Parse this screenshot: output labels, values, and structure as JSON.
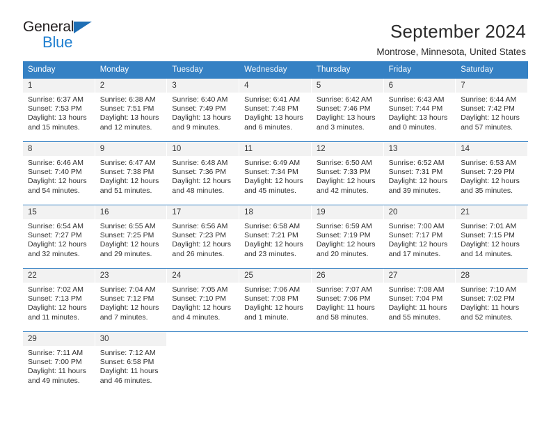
{
  "brand": {
    "name_part1": "General",
    "name_part2": "Blue",
    "triangle_icon": "triangle-icon",
    "accent_color": "#1f7fd0",
    "logo_dark_color": "#231f20"
  },
  "header": {
    "title": "September 2024",
    "subtitle": "Montrose, Minnesota, United States"
  },
  "theme": {
    "header_bar_color": "#3581c4",
    "daynum_band_color": "#f2f2f2",
    "text_color": "#2f2f2f"
  },
  "weekdays": [
    "Sunday",
    "Monday",
    "Tuesday",
    "Wednesday",
    "Thursday",
    "Friday",
    "Saturday"
  ],
  "weeks": [
    {
      "days": [
        {
          "num": "1",
          "sunrise": "Sunrise: 6:37 AM",
          "sunset": "Sunset: 7:53 PM",
          "daylight_line1": "Daylight: 13 hours",
          "daylight_line2": "and 15 minutes."
        },
        {
          "num": "2",
          "sunrise": "Sunrise: 6:38 AM",
          "sunset": "Sunset: 7:51 PM",
          "daylight_line1": "Daylight: 13 hours",
          "daylight_line2": "and 12 minutes."
        },
        {
          "num": "3",
          "sunrise": "Sunrise: 6:40 AM",
          "sunset": "Sunset: 7:49 PM",
          "daylight_line1": "Daylight: 13 hours",
          "daylight_line2": "and 9 minutes."
        },
        {
          "num": "4",
          "sunrise": "Sunrise: 6:41 AM",
          "sunset": "Sunset: 7:48 PM",
          "daylight_line1": "Daylight: 13 hours",
          "daylight_line2": "and 6 minutes."
        },
        {
          "num": "5",
          "sunrise": "Sunrise: 6:42 AM",
          "sunset": "Sunset: 7:46 PM",
          "daylight_line1": "Daylight: 13 hours",
          "daylight_line2": "and 3 minutes."
        },
        {
          "num": "6",
          "sunrise": "Sunrise: 6:43 AM",
          "sunset": "Sunset: 7:44 PM",
          "daylight_line1": "Daylight: 13 hours",
          "daylight_line2": "and 0 minutes."
        },
        {
          "num": "7",
          "sunrise": "Sunrise: 6:44 AM",
          "sunset": "Sunset: 7:42 PM",
          "daylight_line1": "Daylight: 12 hours",
          "daylight_line2": "and 57 minutes."
        }
      ]
    },
    {
      "days": [
        {
          "num": "8",
          "sunrise": "Sunrise: 6:46 AM",
          "sunset": "Sunset: 7:40 PM",
          "daylight_line1": "Daylight: 12 hours",
          "daylight_line2": "and 54 minutes."
        },
        {
          "num": "9",
          "sunrise": "Sunrise: 6:47 AM",
          "sunset": "Sunset: 7:38 PM",
          "daylight_line1": "Daylight: 12 hours",
          "daylight_line2": "and 51 minutes."
        },
        {
          "num": "10",
          "sunrise": "Sunrise: 6:48 AM",
          "sunset": "Sunset: 7:36 PM",
          "daylight_line1": "Daylight: 12 hours",
          "daylight_line2": "and 48 minutes."
        },
        {
          "num": "11",
          "sunrise": "Sunrise: 6:49 AM",
          "sunset": "Sunset: 7:34 PM",
          "daylight_line1": "Daylight: 12 hours",
          "daylight_line2": "and 45 minutes."
        },
        {
          "num": "12",
          "sunrise": "Sunrise: 6:50 AM",
          "sunset": "Sunset: 7:33 PM",
          "daylight_line1": "Daylight: 12 hours",
          "daylight_line2": "and 42 minutes."
        },
        {
          "num": "13",
          "sunrise": "Sunrise: 6:52 AM",
          "sunset": "Sunset: 7:31 PM",
          "daylight_line1": "Daylight: 12 hours",
          "daylight_line2": "and 39 minutes."
        },
        {
          "num": "14",
          "sunrise": "Sunrise: 6:53 AM",
          "sunset": "Sunset: 7:29 PM",
          "daylight_line1": "Daylight: 12 hours",
          "daylight_line2": "and 35 minutes."
        }
      ]
    },
    {
      "days": [
        {
          "num": "15",
          "sunrise": "Sunrise: 6:54 AM",
          "sunset": "Sunset: 7:27 PM",
          "daylight_line1": "Daylight: 12 hours",
          "daylight_line2": "and 32 minutes."
        },
        {
          "num": "16",
          "sunrise": "Sunrise: 6:55 AM",
          "sunset": "Sunset: 7:25 PM",
          "daylight_line1": "Daylight: 12 hours",
          "daylight_line2": "and 29 minutes."
        },
        {
          "num": "17",
          "sunrise": "Sunrise: 6:56 AM",
          "sunset": "Sunset: 7:23 PM",
          "daylight_line1": "Daylight: 12 hours",
          "daylight_line2": "and 26 minutes."
        },
        {
          "num": "18",
          "sunrise": "Sunrise: 6:58 AM",
          "sunset": "Sunset: 7:21 PM",
          "daylight_line1": "Daylight: 12 hours",
          "daylight_line2": "and 23 minutes."
        },
        {
          "num": "19",
          "sunrise": "Sunrise: 6:59 AM",
          "sunset": "Sunset: 7:19 PM",
          "daylight_line1": "Daylight: 12 hours",
          "daylight_line2": "and 20 minutes."
        },
        {
          "num": "20",
          "sunrise": "Sunrise: 7:00 AM",
          "sunset": "Sunset: 7:17 PM",
          "daylight_line1": "Daylight: 12 hours",
          "daylight_line2": "and 17 minutes."
        },
        {
          "num": "21",
          "sunrise": "Sunrise: 7:01 AM",
          "sunset": "Sunset: 7:15 PM",
          "daylight_line1": "Daylight: 12 hours",
          "daylight_line2": "and 14 minutes."
        }
      ]
    },
    {
      "days": [
        {
          "num": "22",
          "sunrise": "Sunrise: 7:02 AM",
          "sunset": "Sunset: 7:13 PM",
          "daylight_line1": "Daylight: 12 hours",
          "daylight_line2": "and 11 minutes."
        },
        {
          "num": "23",
          "sunrise": "Sunrise: 7:04 AM",
          "sunset": "Sunset: 7:12 PM",
          "daylight_line1": "Daylight: 12 hours",
          "daylight_line2": "and 7 minutes."
        },
        {
          "num": "24",
          "sunrise": "Sunrise: 7:05 AM",
          "sunset": "Sunset: 7:10 PM",
          "daylight_line1": "Daylight: 12 hours",
          "daylight_line2": "and 4 minutes."
        },
        {
          "num": "25",
          "sunrise": "Sunrise: 7:06 AM",
          "sunset": "Sunset: 7:08 PM",
          "daylight_line1": "Daylight: 12 hours",
          "daylight_line2": "and 1 minute."
        },
        {
          "num": "26",
          "sunrise": "Sunrise: 7:07 AM",
          "sunset": "Sunset: 7:06 PM",
          "daylight_line1": "Daylight: 11 hours",
          "daylight_line2": "and 58 minutes."
        },
        {
          "num": "27",
          "sunrise": "Sunrise: 7:08 AM",
          "sunset": "Sunset: 7:04 PM",
          "daylight_line1": "Daylight: 11 hours",
          "daylight_line2": "and 55 minutes."
        },
        {
          "num": "28",
          "sunrise": "Sunrise: 7:10 AM",
          "sunset": "Sunset: 7:02 PM",
          "daylight_line1": "Daylight: 11 hours",
          "daylight_line2": "and 52 minutes."
        }
      ]
    },
    {
      "days": [
        {
          "num": "29",
          "sunrise": "Sunrise: 7:11 AM",
          "sunset": "Sunset: 7:00 PM",
          "daylight_line1": "Daylight: 11 hours",
          "daylight_line2": "and 49 minutes."
        },
        {
          "num": "30",
          "sunrise": "Sunrise: 7:12 AM",
          "sunset": "Sunset: 6:58 PM",
          "daylight_line1": "Daylight: 11 hours",
          "daylight_line2": "and 46 minutes."
        },
        {
          "num": "",
          "sunrise": "",
          "sunset": "",
          "daylight_line1": "",
          "daylight_line2": ""
        },
        {
          "num": "",
          "sunrise": "",
          "sunset": "",
          "daylight_line1": "",
          "daylight_line2": ""
        },
        {
          "num": "",
          "sunrise": "",
          "sunset": "",
          "daylight_line1": "",
          "daylight_line2": ""
        },
        {
          "num": "",
          "sunrise": "",
          "sunset": "",
          "daylight_line1": "",
          "daylight_line2": ""
        },
        {
          "num": "",
          "sunrise": "",
          "sunset": "",
          "daylight_line1": "",
          "daylight_line2": ""
        }
      ]
    }
  ]
}
